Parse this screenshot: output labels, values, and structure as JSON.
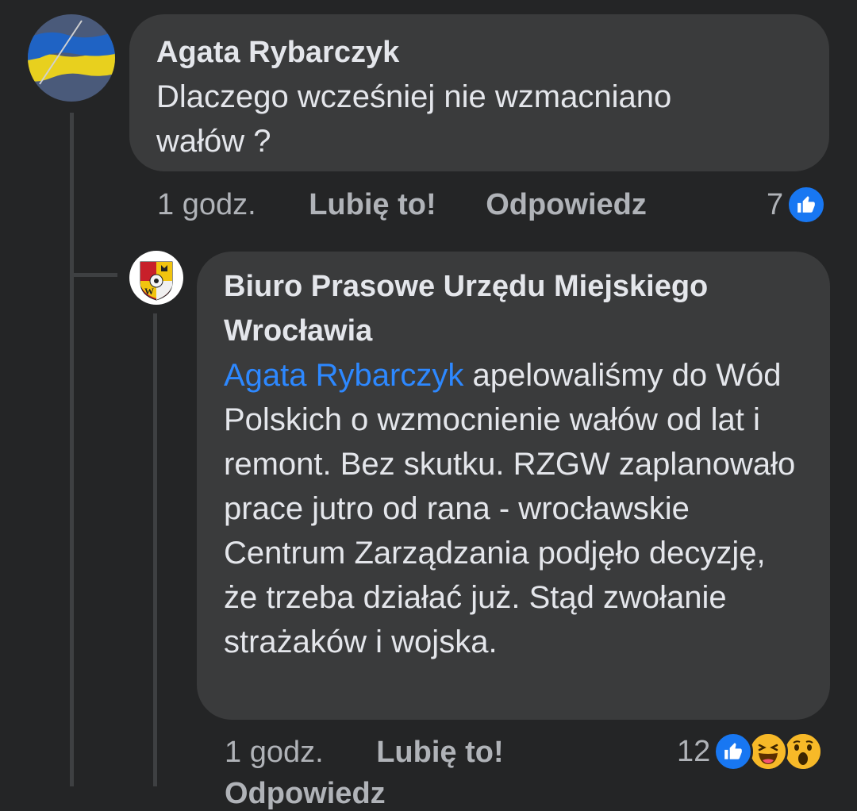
{
  "comments": [
    {
      "author": "Agata Rybarczyk",
      "text": "Dlaczego wcześniej nie wzmacniano wałów ?",
      "time": "1 godz.",
      "like_label": "Lubię to!",
      "reply_label": "Odpowiedz",
      "reaction_count": "7",
      "reactions": [
        "like-icon"
      ]
    },
    {
      "author": "Biuro Prasowe Urzędu Miejskiego Wrocławia",
      "mention": "Agata Rybarczyk",
      "text": " apelowaliśmy do Wód Polskich o wzmocnienie wałów od lat i remont. Bez skutku. RZGW zaplanowało prace jutro od rana - wrocławskie Centrum Zarządzania podjęło decyzję, że trzeba działać już. Stąd zwołanie strażaków i wojska.",
      "time": "1 godz.",
      "like_label": "Lubię to!",
      "reply_label": "Odpowiedz",
      "reaction_count": "12",
      "reactions": [
        "like-icon",
        "haha-icon",
        "wow-icon"
      ]
    }
  ],
  "colors": {
    "background": "#242526",
    "bubble": "#3a3b3c",
    "mention": "#2d88ff",
    "like_blue": "#1877f2",
    "muted_text": "#b0b3b8"
  }
}
